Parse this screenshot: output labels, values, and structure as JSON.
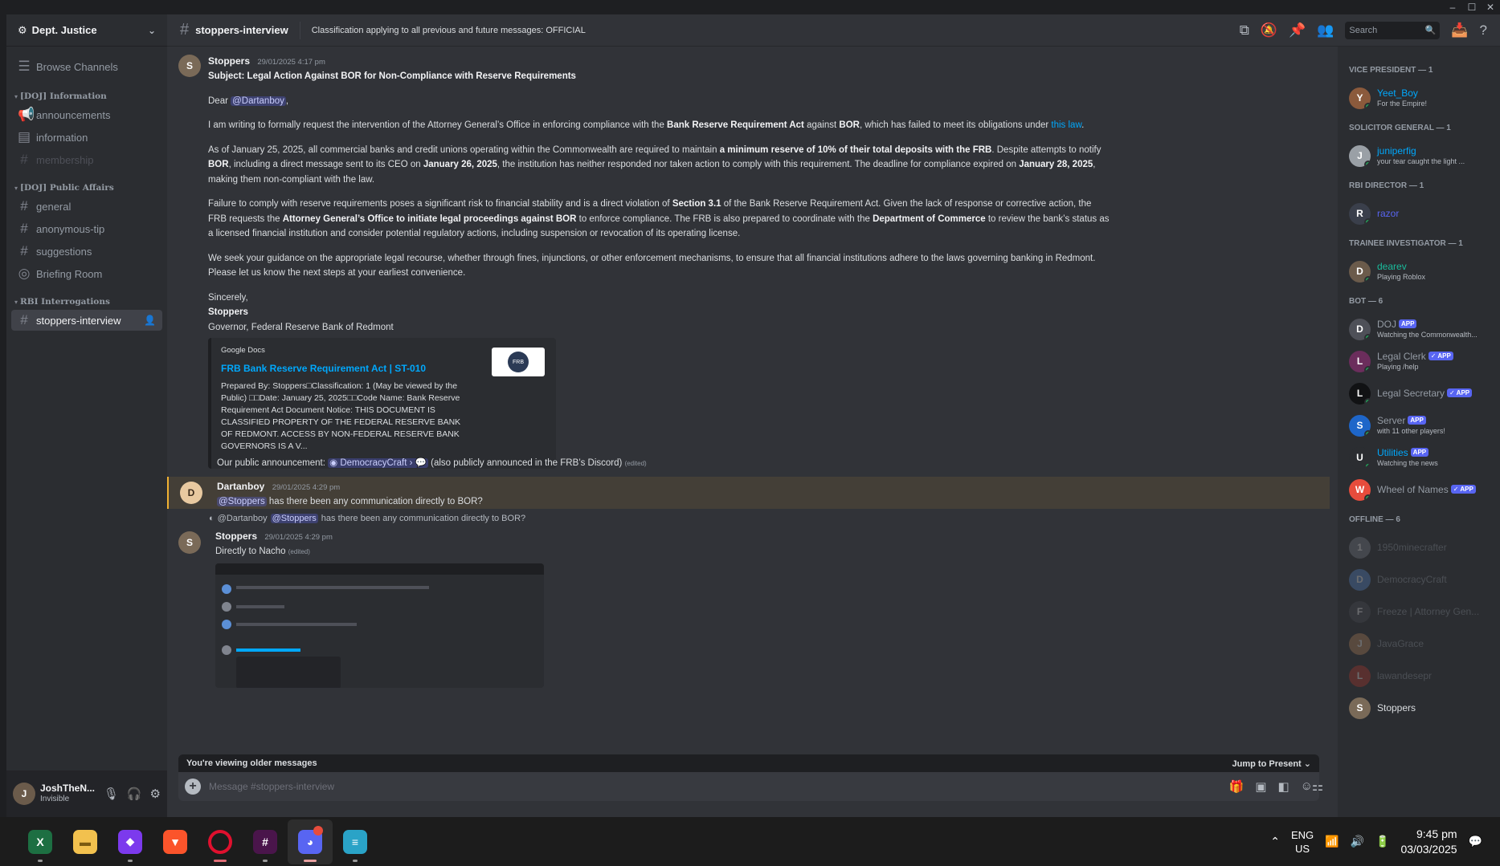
{
  "window": {
    "controls": [
      "–",
      "☐",
      "✕"
    ]
  },
  "server": {
    "name": "Dept. Justice"
  },
  "sidebar": {
    "browse": "Browse Channels",
    "categories": [
      {
        "name": "[DOJ] Information",
        "channels": [
          "announcements",
          "information",
          "membership"
        ]
      },
      {
        "name": "[DOJ] Public Affairs",
        "channels": [
          "general",
          "anonymous-tip",
          "suggestions",
          "Briefing Room"
        ]
      },
      {
        "name": "RBI Interrogations",
        "channels": [
          "stoppers-interview"
        ]
      }
    ]
  },
  "user": {
    "name": "JoshTheN...",
    "status": "Invisible"
  },
  "header": {
    "channel": "stoppers-interview",
    "topic": "Classification applying to all previous and future messages: OFFICIAL",
    "search_placeholder": "Search"
  },
  "messages": {
    "m1": {
      "author": "Stoppers",
      "timestamp": "29/01/2025 4:17 pm",
      "subject": "Subject: Legal Action Against BOR for Non-Compliance with Reserve Requirements",
      "greeting_pre": "Dear ",
      "greeting_mention": "@Dartanboy",
      "greeting_post": ",",
      "p1_a": "I am writing to formally request the intervention of the Attorney General’s Office in enforcing compliance with the ",
      "p1_b": "Bank Reserve Requirement Act",
      "p1_c": " against ",
      "p1_d": "BOR",
      "p1_e": ", which has failed to meet its obligations under ",
      "p1_link": "this law",
      "p1_f": ".",
      "p2_a": "As of January 25, 2025, all commercial banks and credit unions operating within the Commonwealth are required to maintain ",
      "p2_b": "a minimum reserve of 10% of their total deposits with the FRB",
      "p2_c": ". Despite attempts to notify ",
      "p2_d": "BOR",
      "p2_e": ", including a direct message sent to its CEO on ",
      "p2_f": "January 26, 2025",
      "p2_g": ", the institution has neither responded nor taken action to comply with this requirement. The deadline for compliance expired on ",
      "p2_h": "January 28, 2025",
      "p2_i": ", making them non-compliant with the law.",
      "p3_a": "Failure to comply with reserve requirements poses a significant risk to financial stability and is a direct violation of ",
      "p3_b": "Section 3.1",
      "p3_c": " of the Bank Reserve Requirement Act. Given the lack of response or corrective action, the FRB requests the ",
      "p3_d": "Attorney General’s Office to initiate legal proceedings against BOR",
      "p3_e": " to enforce compliance. The FRB is also prepared to coordinate with the ",
      "p3_f": "Department of Commerce",
      "p3_g": " to review the bank’s status as a licensed financial institution and consider potential regulatory actions, including suspension or revocation of its operating license.",
      "p4": "We seek your guidance on the appropriate legal recourse, whether through fines, injunctions, or other enforcement mechanisms, to ensure that all financial institutions adhere to the laws governing banking in Redmont. Please let us know the next steps at your earliest convenience.",
      "closing": "Sincerely,",
      "sig_name": "Stoppers",
      "sig_title": "Governor, Federal Reserve Bank of Redmont",
      "embed": {
        "provider": "Google Docs",
        "title": "FRB Bank Reserve Requirement Act | ST-010",
        "description": "Prepared By: Stoppers□Classification: 1 (May be viewed by the Public) □□Date: January 25, 2025□□Code Name: Bank Reserve Requirement Act Document Notice: THIS DOCUMENT IS CLASSIFIED PROPERTY OF THE FEDERAL RESERVE BANK OF REDMONT. ACCESS BY NON-FEDERAL RESERVE BANK GOVERNORS IS A V...",
        "thumb_text": "FRB"
      }
    },
    "m2": {
      "text_a": "Our public announcement: ",
      "channel_link": "DemocracyCraft",
      "text_b": " (also publicly announced in the FRB’s Discord)",
      "edited": "(edited)"
    },
    "m3": {
      "author": "Dartanboy",
      "timestamp": "29/01/2025 4:29 pm",
      "mention": "@Stoppers",
      "text": " has there been any communication directly to BOR?"
    },
    "m4": {
      "reply_author": "@Dartanboy",
      "reply_mention": "@Stoppers",
      "reply_text": "has there been any communication directly to BOR?",
      "author": "Stoppers",
      "timestamp": "29/01/2025 4:29 pm",
      "text": "Directly to Nacho",
      "edited": "(edited)"
    }
  },
  "composer": {
    "older_notice": "You're viewing older messages",
    "jump": "Jump to Present",
    "placeholder": "Message #stoppers-interview"
  },
  "members": {
    "groups": [
      {
        "title": "VICE PRESIDENT — 1",
        "members": [
          {
            "name": "Yeet_Boy",
            "activity": "For the Empire!",
            "color": "#00a8fc",
            "av": "#8b5a3c"
          }
        ]
      },
      {
        "title": "SOLICITOR GENERAL — 1",
        "members": [
          {
            "name": "juniperfig",
            "activity": "your tear caught the light ...",
            "color": "#00a8fc",
            "av": "#9aa0a6"
          }
        ]
      },
      {
        "title": "RBI DIRECTOR — 1",
        "members": [
          {
            "name": "razor",
            "activity": "",
            "color": "#5865f2",
            "av": "#3a3f4b"
          }
        ]
      },
      {
        "title": "TRAINEE INVESTIGATOR — 1",
        "members": [
          {
            "name": "dearev",
            "activity": "Playing Roblox",
            "color": "#1abc9c",
            "av": "#6b5b4b"
          }
        ]
      },
      {
        "title": "BOT — 6",
        "members": [
          {
            "name": "DOJ",
            "activity": "Watching the Commonwealth...",
            "color": "#949ba4",
            "av": "#4e5058",
            "tag": "APP"
          },
          {
            "name": "Legal Clerk",
            "activity": "Playing /help",
            "color": "#949ba4",
            "av": "#6b2d5c",
            "tag": "✓ APP"
          },
          {
            "name": "Legal Secretary",
            "activity": "",
            "color": "#949ba4",
            "av": "#111214",
            "tag": "✓ APP"
          },
          {
            "name": "Server",
            "activity": "with 11 other players!",
            "color": "#949ba4",
            "av": "#1e66c9",
            "tag": "APP"
          },
          {
            "name": "Utilities",
            "activity": "Watching the news",
            "color": "#00a8fc",
            "av": "#2b2d31",
            "tag": "APP"
          },
          {
            "name": "Wheel of Names",
            "activity": "",
            "color": "#949ba4",
            "av": "#e74c3c",
            "tag": "✓ APP"
          }
        ]
      },
      {
        "title": "OFFLINE — 6",
        "members": [
          {
            "name": "1950minecrafter",
            "activity": "",
            "color": "#949ba4",
            "av": "#80848e",
            "off": true
          },
          {
            "name": "DemocracyCraft",
            "activity": "",
            "color": "#949ba4",
            "av": "#5b8fd6",
            "off": true
          },
          {
            "name": "Freeze | Attorney Gen...",
            "activity": "",
            "color": "#949ba4",
            "av": "#4e5058",
            "off": true
          },
          {
            "name": "JavaGrace",
            "activity": "",
            "color": "#949ba4",
            "av": "#c08a5c",
            "off": true
          },
          {
            "name": "lawandesepr",
            "activity": "",
            "color": "#949ba4",
            "av": "#c0392b",
            "off": true
          },
          {
            "name": "Stoppers",
            "activity": "",
            "color": "#dbdee1",
            "av": "#7a6a58",
            "off": false
          }
        ]
      }
    ]
  },
  "taskbar": {
    "apps": [
      "excel-icon",
      "file-explorer-icon",
      "obsidian-icon",
      "brave-icon",
      "opera-icon",
      "slack-icon",
      "discord-icon",
      "database-icon"
    ],
    "lang_top": "ENG",
    "lang_bottom": "US",
    "time": "9:45 pm",
    "date": "03/03/2025"
  },
  "colors": {
    "accent": "#5865f2",
    "link": "#00a8fc",
    "highlight": "#f0b132"
  }
}
